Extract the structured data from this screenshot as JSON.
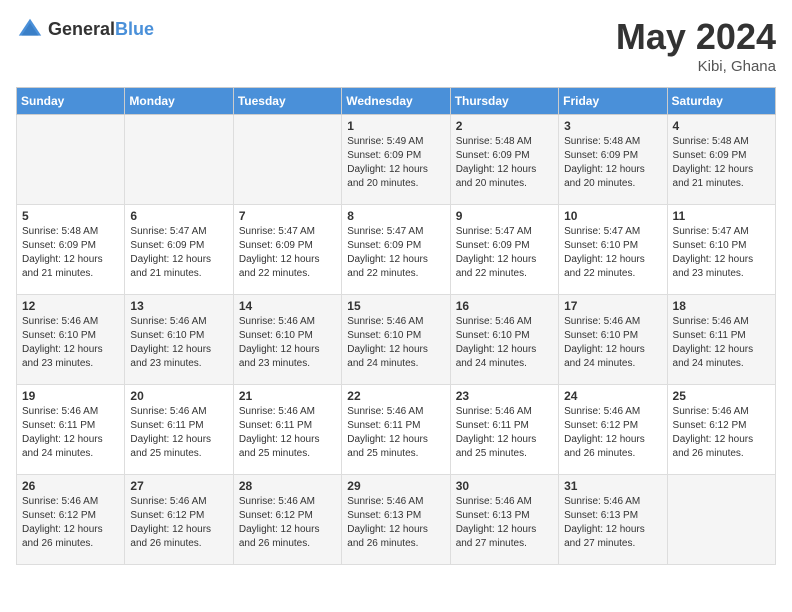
{
  "header": {
    "logo_general": "General",
    "logo_blue": "Blue",
    "month_title": "May 2024",
    "location": "Kibi, Ghana"
  },
  "days_of_week": [
    "Sunday",
    "Monday",
    "Tuesday",
    "Wednesday",
    "Thursday",
    "Friday",
    "Saturday"
  ],
  "weeks": [
    [
      {
        "day": "",
        "content": ""
      },
      {
        "day": "",
        "content": ""
      },
      {
        "day": "",
        "content": ""
      },
      {
        "day": "1",
        "content": "Sunrise: 5:49 AM\nSunset: 6:09 PM\nDaylight: 12 hours and 20 minutes."
      },
      {
        "day": "2",
        "content": "Sunrise: 5:48 AM\nSunset: 6:09 PM\nDaylight: 12 hours and 20 minutes."
      },
      {
        "day": "3",
        "content": "Sunrise: 5:48 AM\nSunset: 6:09 PM\nDaylight: 12 hours and 20 minutes."
      },
      {
        "day": "4",
        "content": "Sunrise: 5:48 AM\nSunset: 6:09 PM\nDaylight: 12 hours and 21 minutes."
      }
    ],
    [
      {
        "day": "5",
        "content": "Sunrise: 5:48 AM\nSunset: 6:09 PM\nDaylight: 12 hours and 21 minutes."
      },
      {
        "day": "6",
        "content": "Sunrise: 5:47 AM\nSunset: 6:09 PM\nDaylight: 12 hours and 21 minutes."
      },
      {
        "day": "7",
        "content": "Sunrise: 5:47 AM\nSunset: 6:09 PM\nDaylight: 12 hours and 22 minutes."
      },
      {
        "day": "8",
        "content": "Sunrise: 5:47 AM\nSunset: 6:09 PM\nDaylight: 12 hours and 22 minutes."
      },
      {
        "day": "9",
        "content": "Sunrise: 5:47 AM\nSunset: 6:09 PM\nDaylight: 12 hours and 22 minutes."
      },
      {
        "day": "10",
        "content": "Sunrise: 5:47 AM\nSunset: 6:10 PM\nDaylight: 12 hours and 22 minutes."
      },
      {
        "day": "11",
        "content": "Sunrise: 5:47 AM\nSunset: 6:10 PM\nDaylight: 12 hours and 23 minutes."
      }
    ],
    [
      {
        "day": "12",
        "content": "Sunrise: 5:46 AM\nSunset: 6:10 PM\nDaylight: 12 hours and 23 minutes."
      },
      {
        "day": "13",
        "content": "Sunrise: 5:46 AM\nSunset: 6:10 PM\nDaylight: 12 hours and 23 minutes."
      },
      {
        "day": "14",
        "content": "Sunrise: 5:46 AM\nSunset: 6:10 PM\nDaylight: 12 hours and 23 minutes."
      },
      {
        "day": "15",
        "content": "Sunrise: 5:46 AM\nSunset: 6:10 PM\nDaylight: 12 hours and 24 minutes."
      },
      {
        "day": "16",
        "content": "Sunrise: 5:46 AM\nSunset: 6:10 PM\nDaylight: 12 hours and 24 minutes."
      },
      {
        "day": "17",
        "content": "Sunrise: 5:46 AM\nSunset: 6:10 PM\nDaylight: 12 hours and 24 minutes."
      },
      {
        "day": "18",
        "content": "Sunrise: 5:46 AM\nSunset: 6:11 PM\nDaylight: 12 hours and 24 minutes."
      }
    ],
    [
      {
        "day": "19",
        "content": "Sunrise: 5:46 AM\nSunset: 6:11 PM\nDaylight: 12 hours and 24 minutes."
      },
      {
        "day": "20",
        "content": "Sunrise: 5:46 AM\nSunset: 6:11 PM\nDaylight: 12 hours and 25 minutes."
      },
      {
        "day": "21",
        "content": "Sunrise: 5:46 AM\nSunset: 6:11 PM\nDaylight: 12 hours and 25 minutes."
      },
      {
        "day": "22",
        "content": "Sunrise: 5:46 AM\nSunset: 6:11 PM\nDaylight: 12 hours and 25 minutes."
      },
      {
        "day": "23",
        "content": "Sunrise: 5:46 AM\nSunset: 6:11 PM\nDaylight: 12 hours and 25 minutes."
      },
      {
        "day": "24",
        "content": "Sunrise: 5:46 AM\nSunset: 6:12 PM\nDaylight: 12 hours and 26 minutes."
      },
      {
        "day": "25",
        "content": "Sunrise: 5:46 AM\nSunset: 6:12 PM\nDaylight: 12 hours and 26 minutes."
      }
    ],
    [
      {
        "day": "26",
        "content": "Sunrise: 5:46 AM\nSunset: 6:12 PM\nDaylight: 12 hours and 26 minutes."
      },
      {
        "day": "27",
        "content": "Sunrise: 5:46 AM\nSunset: 6:12 PM\nDaylight: 12 hours and 26 minutes."
      },
      {
        "day": "28",
        "content": "Sunrise: 5:46 AM\nSunset: 6:12 PM\nDaylight: 12 hours and 26 minutes."
      },
      {
        "day": "29",
        "content": "Sunrise: 5:46 AM\nSunset: 6:13 PM\nDaylight: 12 hours and 26 minutes."
      },
      {
        "day": "30",
        "content": "Sunrise: 5:46 AM\nSunset: 6:13 PM\nDaylight: 12 hours and 27 minutes."
      },
      {
        "day": "31",
        "content": "Sunrise: 5:46 AM\nSunset: 6:13 PM\nDaylight: 12 hours and 27 minutes."
      },
      {
        "day": "",
        "content": ""
      }
    ]
  ]
}
